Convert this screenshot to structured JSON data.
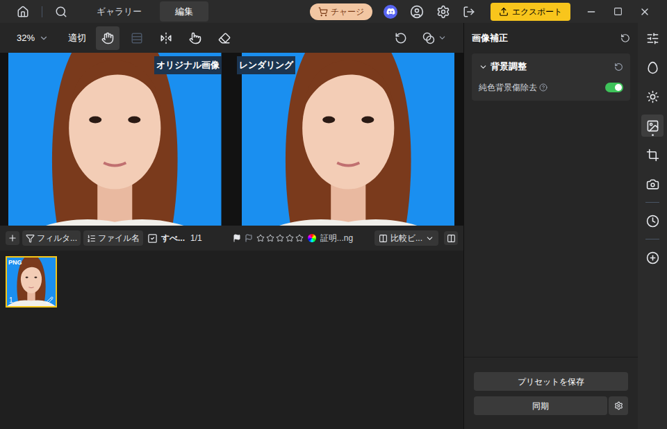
{
  "top_bar": {
    "tabs": [
      {
        "label": "ギャラリー",
        "selected": false
      },
      {
        "label": "編集",
        "selected": true
      }
    ],
    "charge_button": "チャージ",
    "export_button": "エクスポート"
  },
  "toolbar": {
    "zoom": "32%",
    "fit": "適切",
    "tools": [
      {
        "kind": "hand",
        "selected": true,
        "disabled": false
      },
      {
        "kind": "grid",
        "selected": false,
        "disabled": true
      },
      {
        "kind": "flip",
        "selected": false,
        "disabled": false
      },
      {
        "kind": "touch",
        "selected": false,
        "disabled": false
      },
      {
        "kind": "eraser",
        "selected": false,
        "disabled": false
      }
    ]
  },
  "viewer": {
    "labels": [
      "オリジナル画像",
      "レンダリング"
    ]
  },
  "filmstrip_bar": {
    "filter": "フィルタ...",
    "sort": "ファイル名",
    "select_all": {
      "label": "すべ...",
      "checked": true
    },
    "count": "1/1",
    "stars": 0,
    "file_name": "証明...ng",
    "view_mode": "比較ビ..."
  },
  "thumbnails": [
    {
      "badge": "PNG",
      "index": "1",
      "selected": true
    }
  ],
  "panel": {
    "title": "画像補正",
    "sections": [
      {
        "title": "背景調整",
        "expanded": true,
        "options": [
          {
            "label": "純色背景傷除去",
            "on": true
          }
        ]
      }
    ],
    "buttons": [
      "プリセットを保存",
      "同期"
    ]
  },
  "side_tabs": [
    {
      "kind": "sliders",
      "selected": false
    },
    {
      "kind": "face",
      "selected": false
    },
    {
      "kind": "sun",
      "selected": false
    },
    {
      "kind": "image",
      "selected": true
    },
    {
      "kind": "crop",
      "selected": false
    },
    {
      "kind": "camera",
      "selected": false
    },
    {
      "kind": "history",
      "selected": false
    },
    {
      "kind": "add",
      "selected": false
    }
  ]
}
